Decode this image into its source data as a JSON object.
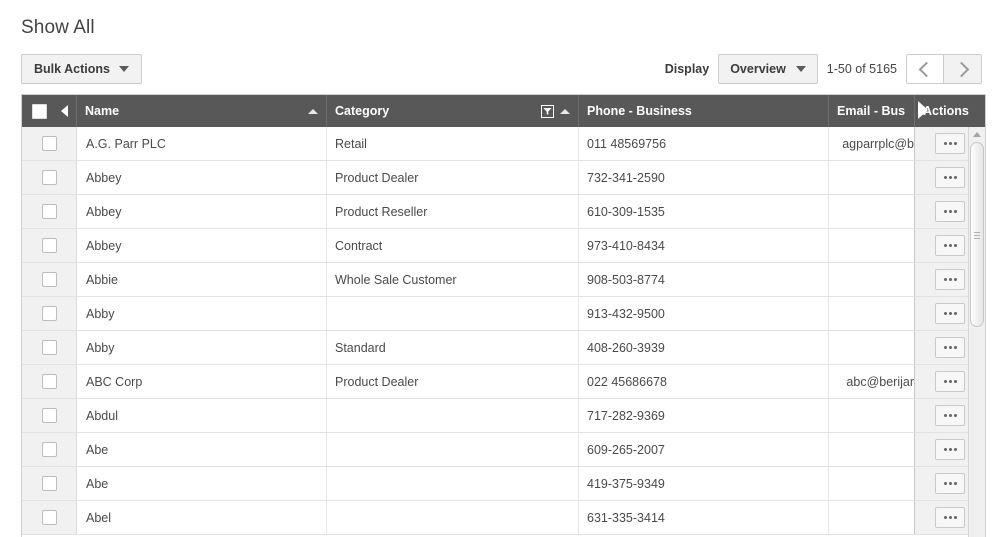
{
  "page": {
    "title": "Show All"
  },
  "toolbar": {
    "bulk_actions_label": "Bulk Actions",
    "display_label": "Display",
    "display_value": "Overview",
    "record_range": "1-50 of 5165",
    "prev_icon": "chevron-left-icon",
    "next_icon": "chevron-right-icon"
  },
  "grid": {
    "columns": [
      {
        "key": "check",
        "label": ""
      },
      {
        "key": "name",
        "label": "Name",
        "sort": "asc"
      },
      {
        "key": "category",
        "label": "Category",
        "sort": "asc",
        "filter": true
      },
      {
        "key": "phone",
        "label": "Phone - Business"
      },
      {
        "key": "email",
        "label": "Email - Bus"
      },
      {
        "key": "actions",
        "label": "Actions"
      }
    ],
    "rows": [
      {
        "name": "A.G. Parr PLC",
        "category": "Retail",
        "phone": "011 48569756",
        "email": "agparrplc@b"
      },
      {
        "name": "Abbey",
        "category": "Product Dealer",
        "phone": "732-341-2590",
        "email": ""
      },
      {
        "name": "Abbey",
        "category": "Product Reseller",
        "phone": "610-309-1535",
        "email": ""
      },
      {
        "name": "Abbey",
        "category": "Contract",
        "phone": "973-410-8434",
        "email": ""
      },
      {
        "name": "Abbie",
        "category": "Whole Sale Customer",
        "phone": "908-503-8774",
        "email": ""
      },
      {
        "name": "Abby",
        "category": "",
        "phone": "913-432-9500",
        "email": ""
      },
      {
        "name": "Abby",
        "category": "Standard",
        "phone": "408-260-3939",
        "email": ""
      },
      {
        "name": "ABC Corp",
        "category": "Product Dealer",
        "phone": "022 45686678",
        "email": "abc@berijar"
      },
      {
        "name": "Abdul",
        "category": "",
        "phone": "717-282-9369",
        "email": ""
      },
      {
        "name": "Abe",
        "category": "",
        "phone": "609-265-2007",
        "email": ""
      },
      {
        "name": "Abe",
        "category": "",
        "phone": "419-375-9349",
        "email": ""
      },
      {
        "name": "Abel",
        "category": "",
        "phone": "631-335-3414",
        "email": ""
      }
    ],
    "row_action_icon": "ellipsis-icon",
    "header_collapse_icon": "chevron-left-icon",
    "header_expand_icon": "chevron-right-icon",
    "filter_icon": "funnel-icon",
    "sort_asc_icon": "triangle-up-icon"
  },
  "colors": {
    "header_bg": "#585858",
    "toolbar_btn_bg": "#f2f2f2",
    "grid_border": "#cfcfcf",
    "text": "#4a4a4a"
  }
}
